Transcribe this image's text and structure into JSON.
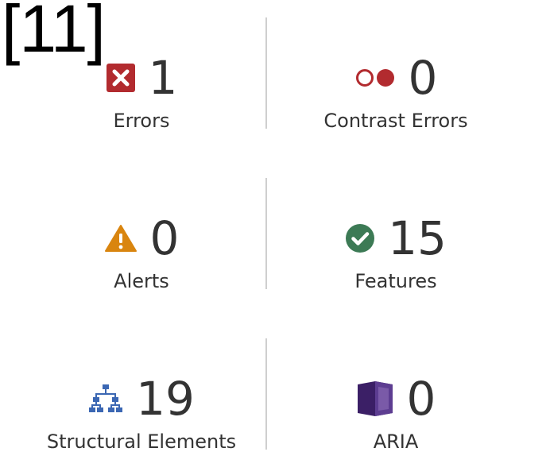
{
  "marker": "[11]",
  "summary": {
    "items": [
      {
        "label": "Errors",
        "count": "1",
        "icon": "error-icon"
      },
      {
        "label": "Contrast Errors",
        "count": "0",
        "icon": "contrast-error-icon"
      },
      {
        "label": "Alerts",
        "count": "0",
        "icon": "alert-icon"
      },
      {
        "label": "Features",
        "count": "15",
        "icon": "feature-icon"
      },
      {
        "label": "Structural Elements",
        "count": "19",
        "icon": "structure-icon"
      },
      {
        "label": "ARIA",
        "count": "0",
        "icon": "aria-icon"
      }
    ]
  },
  "colors": {
    "error": "#b22b2f",
    "alert": "#d9850f",
    "feature": "#3c7a55",
    "structure": "#3b67b3",
    "aria": "#3b1f66",
    "text": "#333333",
    "divider": "#cfcfcf"
  }
}
